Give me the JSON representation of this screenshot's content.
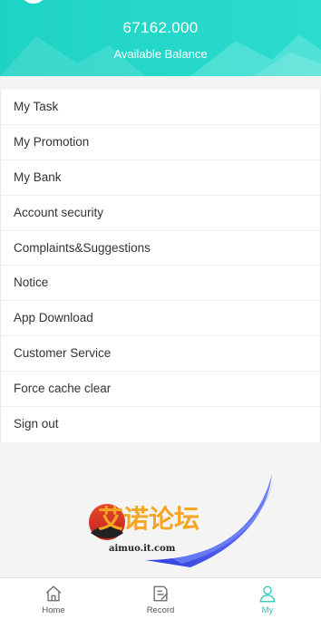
{
  "header": {
    "balance_amount": "67162.000",
    "balance_label": "Available Balance"
  },
  "menu": {
    "items": [
      {
        "label": "My Task"
      },
      {
        "label": "My Promotion"
      },
      {
        "label": "My Bank"
      },
      {
        "label": "Account security"
      },
      {
        "label": "Complaints&Suggestions"
      },
      {
        "label": "Notice"
      },
      {
        "label": "App Download"
      },
      {
        "label": "Customer Service"
      },
      {
        "label": "Force cache clear"
      },
      {
        "label": "Sign out"
      }
    ]
  },
  "watermark": {
    "title": "艾诺论坛",
    "url": "aimuo.it.com"
  },
  "tabbar": {
    "tabs": [
      {
        "label": "Home",
        "icon": "home-icon",
        "active": false
      },
      {
        "label": "Record",
        "icon": "record-icon",
        "active": false
      },
      {
        "label": "My",
        "icon": "user-icon",
        "active": true
      }
    ]
  },
  "colors": {
    "accent": "#1fd3c4",
    "active_tab": "#1fc8b8",
    "text": "#333333",
    "background": "#f4f4f4"
  }
}
